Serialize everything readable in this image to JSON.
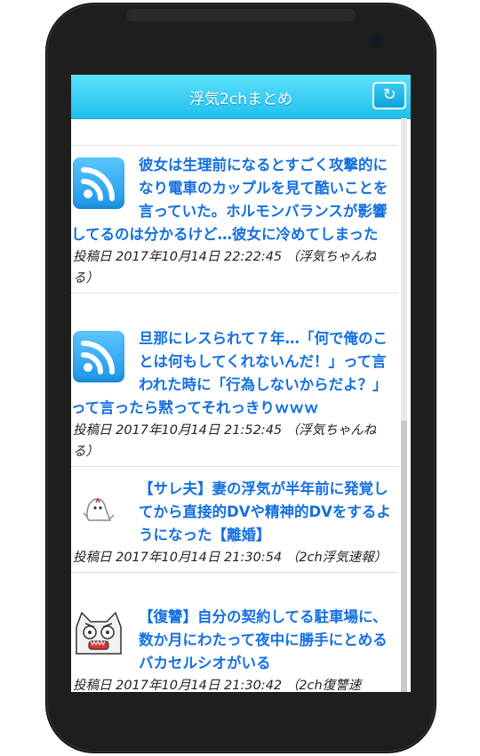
{
  "app": {
    "title": "浮気2chまとめ",
    "refresh_icon": "refresh-icon",
    "accent": "#1ec0ee"
  },
  "articles": [
    {
      "thumb": "rss-icon",
      "title": "彼女は生理前になるとすごく攻撃的になり電車のカップルを見て酷いことを言っていた。ホルモンバランスが影響してるのは分かるけど…彼女に冷めてしまった",
      "meta": "投稿日 2017年10月14日 22:22:45 （浮気ちゃんねる）"
    },
    {
      "thumb": "rss-icon",
      "title": "旦那にレスられて７年…「何で俺のことは何もしてくれないんだ！」って言われた時に「行為しないからだよ？」って言ったら黙ってそれっきりｗｗｗ",
      "meta": "投稿日 2017年10月14日 21:52:45 （浮気ちゃんねる）"
    },
    {
      "thumb": "ghost-character-icon",
      "title": "【サレ夫】妻の浮気が半年前に発覚してから直接的DVや精神的DVをするようになった【離婚】",
      "meta": "投稿日 2017年10月14日 21:30:54 （2ch浮気速報）"
    },
    {
      "thumb": "angry-cat-face-icon",
      "title": "【復讐】自分の契約してる駐車場に、数か月にわたって夜中に勝手にとめるバカセルシオがいる",
      "meta": "投稿日 2017年10月14日 21:30:42 （2ch復讐速"
    }
  ]
}
